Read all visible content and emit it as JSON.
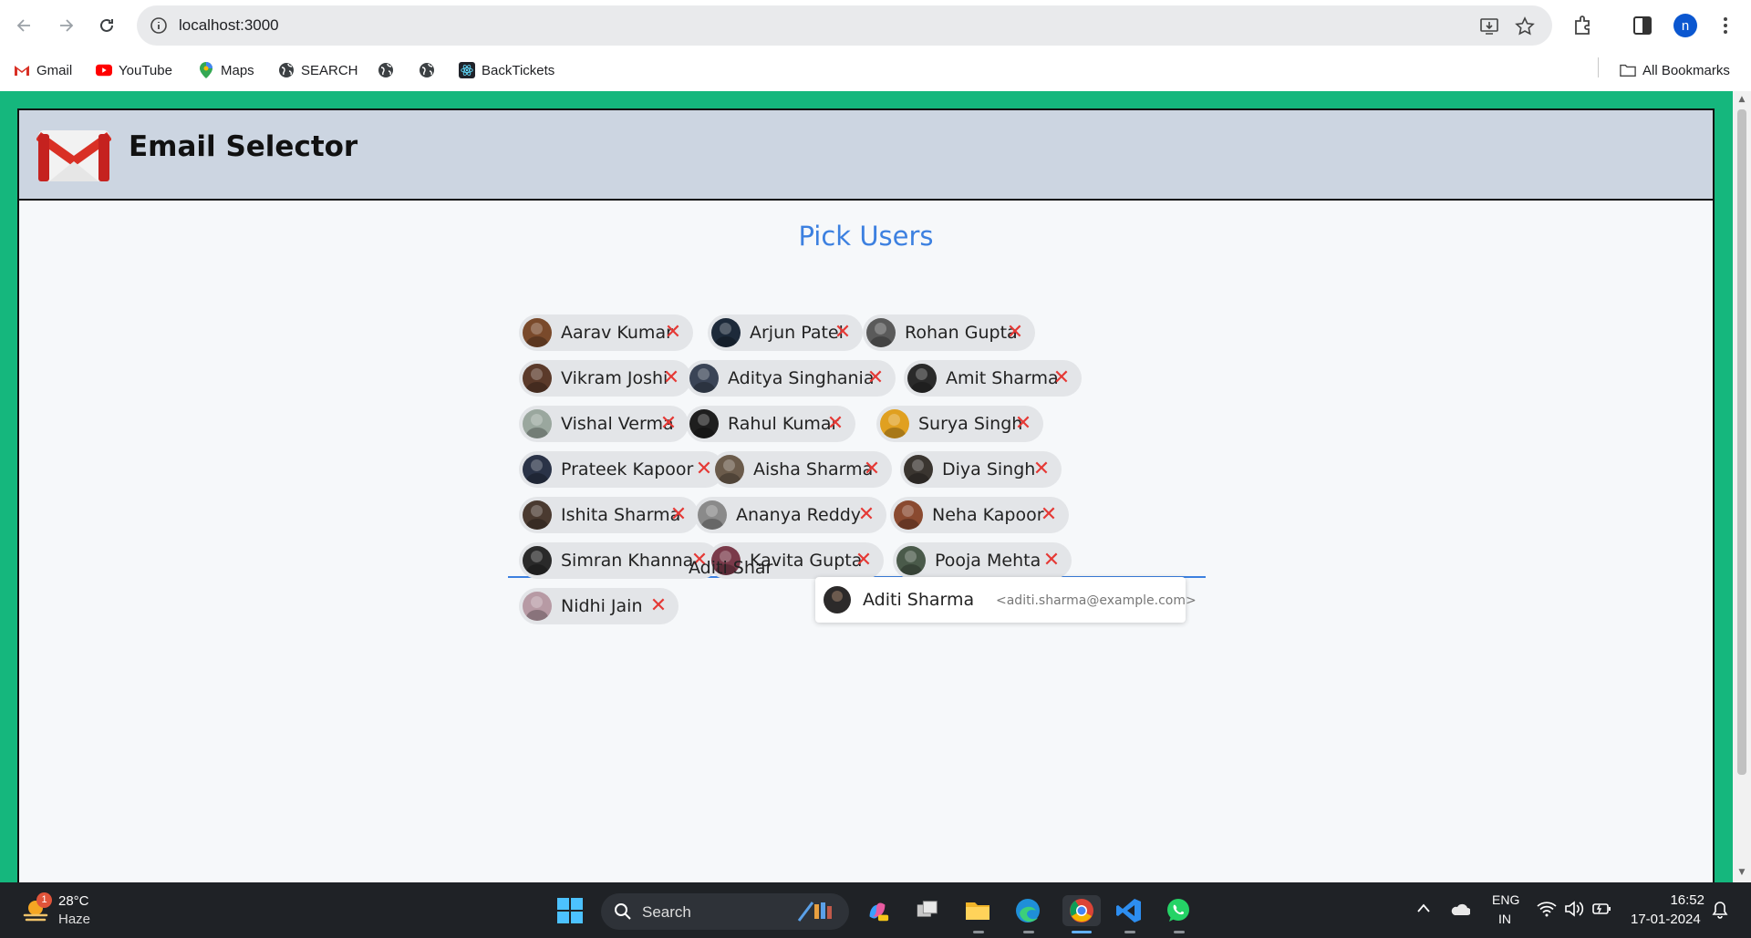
{
  "browser": {
    "url": "localhost:3000",
    "profile_initial": "n",
    "bookmarks": [
      {
        "label": "Gmail",
        "icon": "gmail-icon"
      },
      {
        "label": "YouTube",
        "icon": "youtube-icon"
      },
      {
        "label": "Maps",
        "icon": "maps-icon"
      },
      {
        "label": "SEARCH",
        "icon": "globe-icon"
      },
      {
        "label": "",
        "icon": "globe-icon"
      },
      {
        "label": "",
        "icon": "globe-icon"
      },
      {
        "label": "BackTickets",
        "icon": "react-icon"
      }
    ],
    "all_bookmarks_label": "All Bookmarks"
  },
  "app": {
    "title": "Email Selector",
    "pick_title": "Pick Users",
    "colors": {
      "page_background": "#15b77d",
      "header_background": "#ccd5e1",
      "accent": "#3c80e0",
      "remove": "#e53935"
    },
    "selected_users": [
      {
        "name": "Aarav Kumar",
        "avatar_color": "#7a4a2b"
      },
      {
        "name": "Arjun Patel",
        "avatar_color": "#1d2a3a"
      },
      {
        "name": "Rohan Gupta",
        "avatar_color": "#5a5a5a"
      },
      {
        "name": "Vikram Joshi",
        "avatar_color": "#5b3a2a"
      },
      {
        "name": "Aditya Singhania",
        "avatar_color": "#3a4456"
      },
      {
        "name": "Amit Sharma",
        "avatar_color": "#2a2a2a"
      },
      {
        "name": "Vishal Verma",
        "avatar_color": "#9aa79e"
      },
      {
        "name": "Rahul Kumar",
        "avatar_color": "#1e1e1e"
      },
      {
        "name": "Surya Singh",
        "avatar_color": "#e0a020"
      },
      {
        "name": "Prateek Kapoor",
        "avatar_color": "#2a3347"
      },
      {
        "name": "Aisha Sharma",
        "avatar_color": "#6b5b4b"
      },
      {
        "name": "Diya Singh",
        "avatar_color": "#3a3530"
      },
      {
        "name": "Ishita Sharma",
        "avatar_color": "#4a3a30"
      },
      {
        "name": "Ananya Reddy",
        "avatar_color": "#8a8a8a"
      },
      {
        "name": "Neha Kapoor",
        "avatar_color": "#8a4a30"
      },
      {
        "name": "Simran Khanna",
        "avatar_color": "#2a2a2a"
      },
      {
        "name": "Kavita Gupta",
        "avatar_color": "#7a3a4a"
      },
      {
        "name": "Pooja Mehta",
        "avatar_color": "#4a5a4a"
      },
      {
        "name": "Nidhi Jain",
        "avatar_color": "#b79aa4"
      }
    ],
    "search_value": "Aditi Shar",
    "suggestions": [
      {
        "name": "Aditi Sharma",
        "email": "<aditi.sharma@example.com>"
      }
    ]
  },
  "taskbar": {
    "weather_temp": "28°C",
    "weather_desc": "Haze",
    "weather_badge": "1",
    "search_label": "Search",
    "language_line1": "ENG",
    "language_line2": "IN",
    "time": "16:52",
    "date": "17-01-2024"
  }
}
